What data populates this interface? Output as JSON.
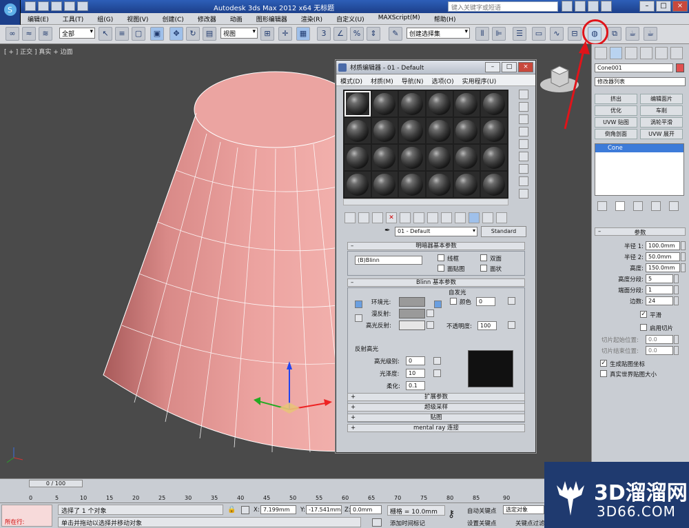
{
  "window": {
    "title": "Autodesk 3ds Max  2012 x64      无标题",
    "search_placeholder": "键入关键字或短语"
  },
  "menu": [
    "编辑(E)",
    "工具(T)",
    "组(G)",
    "视图(V)",
    "创建(C)",
    "修改器",
    "动画",
    "图形编辑器",
    "渲染(R)",
    "自定义(U)",
    "MAXScript(M)",
    "帮助(H)"
  ],
  "toolbar": {
    "selection_filter": "全部",
    "coord_system": "视图",
    "named_selection": "创建选择集"
  },
  "viewport": {
    "label": "[ + ] 正交 ] 真实 + 边面"
  },
  "material_editor": {
    "title": "材质编辑器 - 01 - Default",
    "menu": [
      "模式(D)",
      "材质(M)",
      "导航(N)",
      "选项(O)",
      "实用程序(U)"
    ],
    "material_name": "01 - Default",
    "material_type": "Standard",
    "shader_rollout": "明暗器基本参数",
    "shader": "(B)Blinn",
    "shader_opts": [
      "线框",
      "双面",
      "面贴图",
      "面状"
    ],
    "blinn_rollout": "Blinn 基本参数",
    "ambient": "环境光:",
    "diffuse": "漫反射:",
    "specular": "高光反射:",
    "self_illum": "自发光",
    "color": "颜色",
    "color_value": "0",
    "opacity_label": "不透明度:",
    "opacity": "100",
    "spec_group": "反射高光",
    "spec_level_label": "高光级别:",
    "spec_level": "0",
    "gloss_label": "光泽度:",
    "gloss": "10",
    "soften_label": "柔化:",
    "soften": "0.1",
    "collapsed_rollouts": [
      "扩展参数",
      "超级采样",
      "贴图",
      "mental ray 连接"
    ]
  },
  "command_panel": {
    "object_name": "Cone001",
    "object_color": "#e05050",
    "modifier_list": "修改器列表",
    "buttons": [
      "挤出",
      "编辑面片",
      "优化",
      "车削",
      "UVW 贴图",
      "涡轮平滑",
      "倒角剖面",
      "UVW 展开"
    ],
    "stack_item": "Cone",
    "params_title": "参数",
    "params": [
      {
        "label": "半径 1:",
        "value": "100.0mm"
      },
      {
        "label": "半径 2:",
        "value": "50.0mm"
      },
      {
        "label": "高度:",
        "value": "150.0mm"
      },
      {
        "label": "高度分段:",
        "value": "5"
      },
      {
        "label": "端面分段:",
        "value": "1"
      },
      {
        "label": "边数:",
        "value": "24"
      }
    ],
    "smooth": "平滑",
    "slice_on": "启用切片",
    "slice_from": {
      "label": "切片起始位置:",
      "value": "0.0"
    },
    "slice_to": {
      "label": "切片结束位置:",
      "value": "0.0"
    },
    "gen_map": "生成贴图坐标",
    "real_world": "真实世界贴图大小"
  },
  "timeline": {
    "frame": "0 / 100",
    "ticks": [
      "0",
      "5",
      "10",
      "15",
      "20",
      "25",
      "30",
      "35",
      "40",
      "45",
      "50",
      "55",
      "60",
      "65",
      "70",
      "75",
      "80",
      "85",
      "90"
    ]
  },
  "status": {
    "script_prompt": "所在行:",
    "selected": "选择了 1 个对象",
    "hint": "单击并拖动以选择并移动对象",
    "x_label": "X:",
    "x": "7.199mm",
    "y_label": "Y:",
    "y": "-17.541mm",
    "z_label": "Z:",
    "z": "0.0mm",
    "grid": "栅格 = 10.0mm",
    "autokey": "自动关键点",
    "selected_obj": "选定对象",
    "setkey": "设置关键点",
    "add_tag": "添加时间标记",
    "key_filter": "关键点过滤器..."
  },
  "watermark": {
    "brand": "3D溜溜网",
    "url": "3D66.COM"
  }
}
